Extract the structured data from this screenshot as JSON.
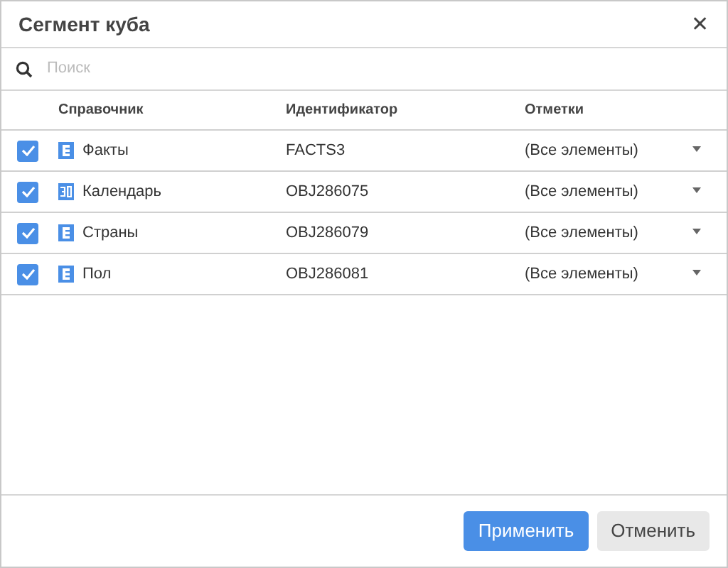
{
  "window": {
    "title": "Сегмент куба",
    "close": "✕"
  },
  "search": {
    "placeholder": "Поиск"
  },
  "table": {
    "columns": [
      "Справочник",
      "Идентификатор",
      "Отметки"
    ],
    "rows": [
      {
        "checked": true,
        "kind": "dictionary",
        "name": "Факты",
        "id": "FACTS3",
        "marks": "(Все элементы)"
      },
      {
        "checked": true,
        "kind": "calendar",
        "name": "Календарь",
        "id": "OBJ286075",
        "marks": "(Все элементы)"
      },
      {
        "checked": true,
        "kind": "dictionary",
        "name": "Страны",
        "id": "OBJ286079",
        "marks": "(Все элементы)"
      },
      {
        "checked": true,
        "kind": "dictionary",
        "name": "Пол",
        "id": "OBJ286081",
        "marks": "(Все элементы)"
      }
    ]
  },
  "buttons": [
    {
      "label": "Применить",
      "kind": "primary"
    },
    {
      "label": "Отменить",
      "kind": "secondary"
    }
  ]
}
